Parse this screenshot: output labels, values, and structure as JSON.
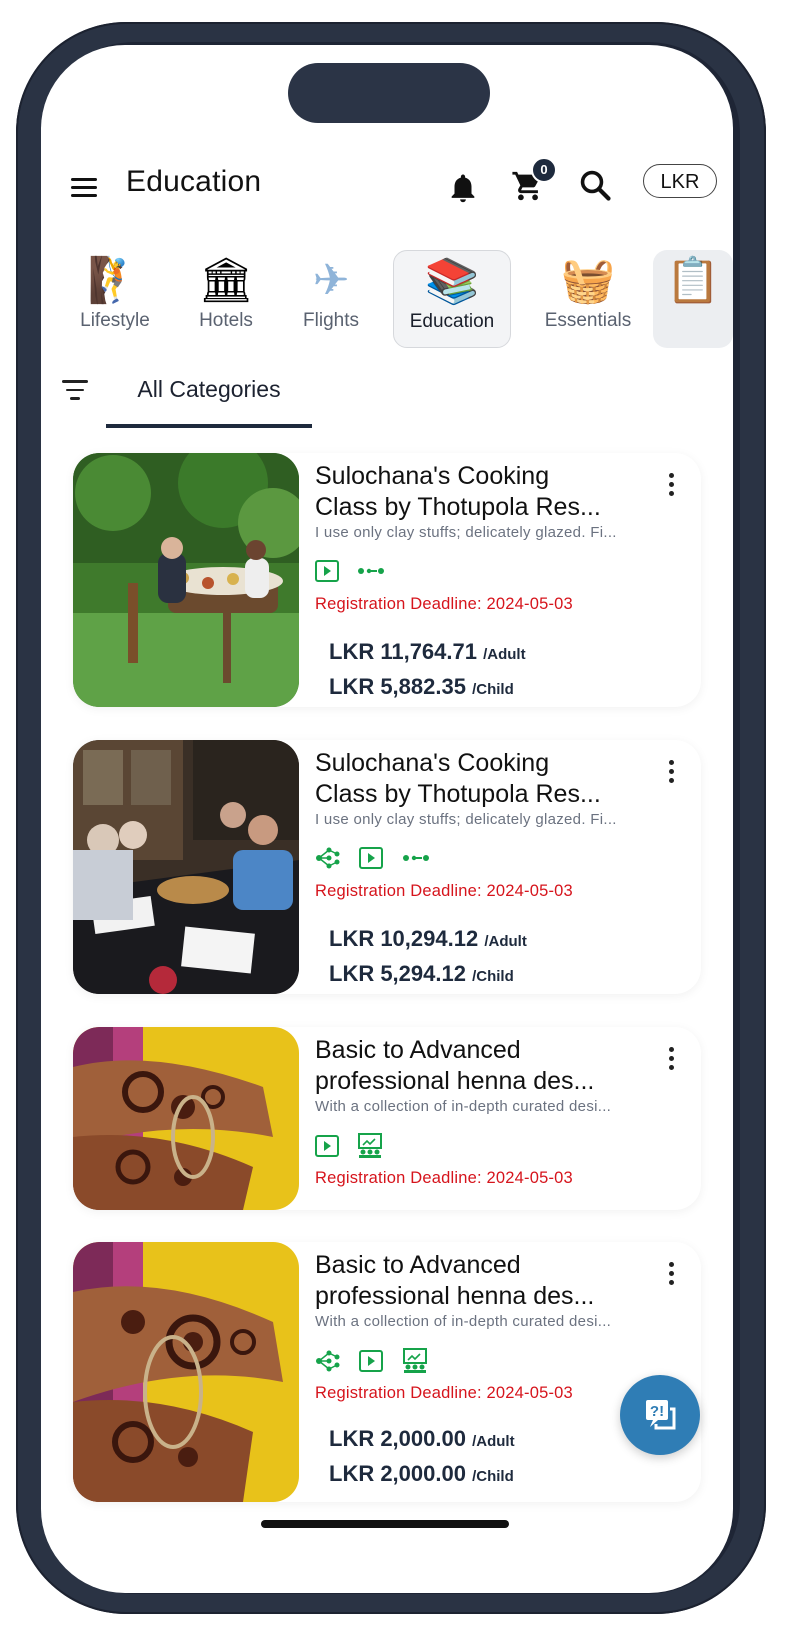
{
  "header": {
    "title": "Education",
    "cart_count": "0",
    "currency": "LKR"
  },
  "categories": [
    {
      "label": "Lifestyle",
      "icon": "lifestyle-icon",
      "glyph": "🧗"
    },
    {
      "label": "Hotels",
      "icon": "hotel-icon",
      "glyph": "🏛"
    },
    {
      "label": "Flights",
      "icon": "airplane-icon",
      "glyph": "✈"
    },
    {
      "label": "Education",
      "icon": "books-icon",
      "glyph": "📚",
      "active": true
    },
    {
      "label": "Essentials",
      "icon": "basket-icon",
      "glyph": "🧺"
    },
    {
      "label": "",
      "icon": "clipboard-icon",
      "glyph": "📋"
    }
  ],
  "tabs": {
    "all_categories": "All Categories"
  },
  "listings": [
    {
      "title_line1": "Sulochana's Cooking",
      "title_line2": "Class by Thotupola Res...",
      "description": "I use only clay stuffs; delicately glazed. Fi...",
      "features": [
        "video-icon",
        "dots-line-icon"
      ],
      "deadline": "Registration Deadline: 2024-05-03",
      "price_adult": "LKR 11,764.71",
      "price_adult_unit": "/Adult",
      "price_child": "LKR 5,882.35",
      "price_child_unit": "/Child"
    },
    {
      "title_line1": "Sulochana's Cooking",
      "title_line2": "Class by Thotupola Res...",
      "description": "I use only clay stuffs; delicately glazed. Fi...",
      "features": [
        "network-icon",
        "video-icon",
        "dots-line-icon"
      ],
      "deadline": "Registration Deadline: 2024-05-03",
      "price_adult": "LKR 10,294.12",
      "price_adult_unit": "/Adult",
      "price_child": "LKR 5,294.12",
      "price_child_unit": "/Child"
    },
    {
      "title_line1": "Basic to Advanced",
      "title_line2": "professional henna des...",
      "description": "With a collection of in-depth curated desi...",
      "features": [
        "video-icon",
        "classroom-icon"
      ],
      "deadline": "Registration Deadline: 2024-05-03"
    },
    {
      "title_line1": "Basic to Advanced",
      "title_line2": "professional henna des...",
      "description": "With a collection of in-depth curated desi...",
      "features": [
        "network-icon",
        "video-icon",
        "classroom-icon"
      ],
      "deadline": "Registration Deadline: 2024-05-03",
      "price_adult": "LKR 2,000.00",
      "price_adult_unit": "/Adult",
      "price_child": "LKR 2,000.00",
      "price_child_unit": "/Child"
    }
  ],
  "colors": {
    "accent_dark": "#1e2a3d",
    "deadline_red": "#d6141c",
    "feature_green": "#16a34a",
    "fab_blue": "#2f7db5"
  }
}
